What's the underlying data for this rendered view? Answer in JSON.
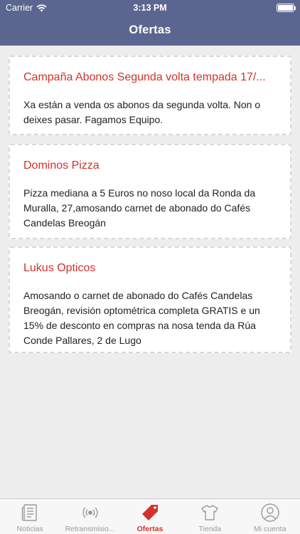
{
  "status_bar": {
    "carrier": "Carrier",
    "time": "3:13 PM",
    "battery_level": 1.0
  },
  "nav": {
    "title": "Ofertas"
  },
  "offers": [
    {
      "title": "Campaña Abonos Segunda volta tempada 17/...",
      "body": "Xa están a venda os abonos da segunda volta. Non o deixes pasar. Fagamos Equipo."
    },
    {
      "title": "Dominos Pizza",
      "body": "Pizza mediana a 5 Euros no noso local da Ronda da Muralla, 27,amosando carnet de abonado do Cafés Candelas Breogán"
    },
    {
      "title": "Lukus Opticos",
      "body": "Amosando o carnet de abonado do Cafés Candelas Breogán, revisión optométrica completa GRATIS e un 15% de desconto en compras na nosa tenda da Rúa Conde Pallares, 2 de Lugo"
    }
  ],
  "tabbar": {
    "active_color": "#d3322b",
    "items": [
      {
        "label": "Noticias",
        "icon": "newspaper-icon"
      },
      {
        "label": "Retransmisio...",
        "icon": "broadcast-icon"
      },
      {
        "label": "Ofertas",
        "icon": "tag-icon"
      },
      {
        "label": "Tienda",
        "icon": "tshirt-icon"
      },
      {
        "label": "Mi cuenta",
        "icon": "user-icon"
      }
    ]
  }
}
